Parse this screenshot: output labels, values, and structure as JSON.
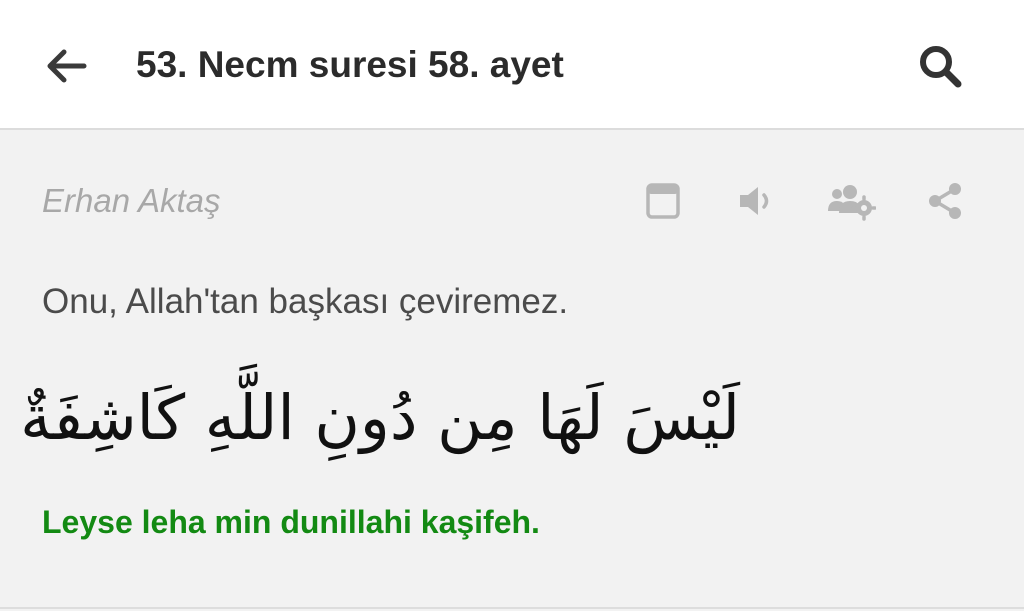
{
  "header": {
    "title": "53. Necm suresi 58. ayet",
    "back_icon": "arrow-left-icon",
    "search_icon": "search-icon"
  },
  "verse": {
    "translator": "Erhan Aktaş",
    "translation": "Onu, Allah'tan başkası çeviremez.",
    "arabic": "لَيْسَ لَهَا مِن دُونِ اللَّهِ كَاشِفَةٌ",
    "transliteration": "Leyse leha min dunillahi kaşifeh.",
    "actions": [
      "book-icon",
      "speaker-icon",
      "users-settings-icon",
      "share-icon"
    ]
  },
  "colors": {
    "transliteration": "#138a13",
    "title": "#2b2b2b",
    "icons_muted": "#b7b7b7",
    "background": "#f2f2f2"
  }
}
